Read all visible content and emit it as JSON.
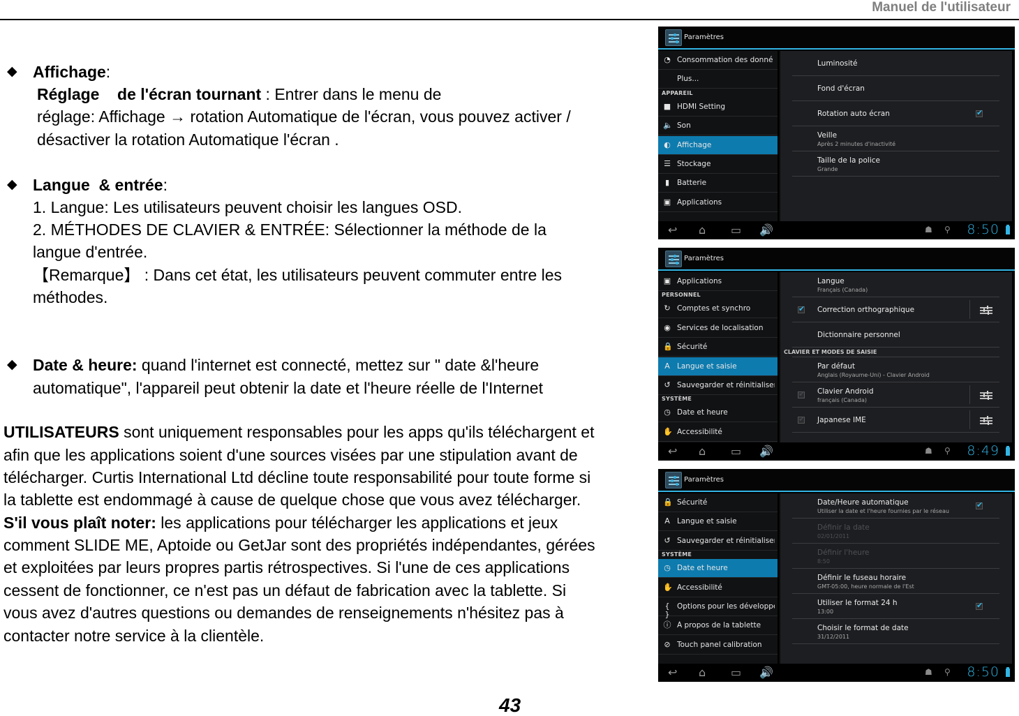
{
  "header": {
    "title": "Manuel de l'utilisateur"
  },
  "page_number": "43",
  "sections": {
    "affichage": {
      "title": "Affichage",
      "colon": ":",
      "subtitle": "Réglage    de l'écran tournant",
      "lines": [
        " : Entrer dans le menu de",
        "réglage: Affichage → rotation Automatique de l'écran, vous pouvez activer /",
        "désactiver la rotation Automatique l'écran ."
      ]
    },
    "langue": {
      "title": "Langue  & entrée",
      "colon": ":",
      "lines": [
        "1. Langue: Les utilisateurs peuvent choisir les langues OSD.",
        "2. MÉTHODES DE CLAVIER & ENTRÉE: Sélectionner la méthode de la",
        "langue d'entrée.",
        "【Remarque】 : Dans cet état, les utilisateurs peuvent commuter entre les",
        "méthodes."
      ]
    },
    "date": {
      "title": "Date & heure:",
      "lines": [
        " quand l'internet est connecté, mettez sur \" date &l'heure",
        "automatique\", l'appareil peut obtenir la date et l'heure réelle de l'Internet"
      ]
    },
    "disclaimer": {
      "lead": "UTILISATEURS",
      "line1_rest": " sont uniquement responsables pour les apps qu'ils téléchargent et",
      "lines": [
        "afin que les applications soient d'une sources visées par une stipulation avant de",
        "télécharger. Curtis International Ltd décline toute responsabilité pour toute forme si",
        "la tablette est endommagé à cause de quelque chose que vous avez télécharger."
      ],
      "note_lead": "S'il vous plaît noter:",
      "note_rest": " les applications pour télécharger les applications et jeux",
      "note_lines": [
        "comment SLIDE ME, Aptoide ou GetJar sont des propriétés indépendantes, gérées",
        "et exploitées par leurs propres partis rétrospectives. Si l'une de ces applications",
        "cessent de fonctionner, ce n'est pas un défaut de fabrication avec la tablette. Si",
        "vous avez d'autres questions ou demandes de renseignements n'hésitez pas à",
        "contacter notre service à la clientèle."
      ]
    }
  },
  "screenshots": [
    {
      "app_title": "Paramètres",
      "clock": "8:50",
      "left_items": [
        {
          "label": "Consommation des donné",
          "icon": "data-usage-icon",
          "glyph": "◔"
        },
        {
          "label": "Plus...",
          "icon": "",
          "glyph": ""
        },
        {
          "section": "APPAREIL"
        },
        {
          "label": "HDMI Setting",
          "icon": "hdmi-icon",
          "glyph": "■"
        },
        {
          "label": "Son",
          "icon": "sound-icon",
          "glyph": "🔈"
        },
        {
          "label": "Affichage",
          "icon": "display-icon",
          "glyph": "◐",
          "selected": true
        },
        {
          "label": "Stockage",
          "icon": "storage-icon",
          "glyph": "☰"
        },
        {
          "label": "Batterie",
          "icon": "battery-icon",
          "glyph": "▮"
        },
        {
          "label": "Applications",
          "icon": "apps-icon",
          "glyph": "▣"
        }
      ],
      "right_items": [
        {
          "title": "Luminosité"
        },
        {
          "title": "Fond d'écran"
        },
        {
          "title": "Rotation auto écran",
          "checked": true
        },
        {
          "title": "Veille",
          "summary": "Après 2 minutes d'inactivité"
        },
        {
          "title": "Taille de la police",
          "summary": "Grande"
        }
      ]
    },
    {
      "app_title": "Paramètres",
      "clock": "8:49",
      "left_items": [
        {
          "label": "Applications",
          "icon": "apps-icon",
          "glyph": "▣"
        },
        {
          "section": "PERSONNEL"
        },
        {
          "label": "Comptes et synchro",
          "icon": "sync-icon",
          "glyph": "↻"
        },
        {
          "label": "Services de localisation",
          "icon": "location-icon",
          "glyph": "◉"
        },
        {
          "label": "Sécurité",
          "icon": "lock-icon",
          "glyph": "🔒"
        },
        {
          "label": "Langue et saisie",
          "icon": "language-icon",
          "glyph": "A",
          "selected": true
        },
        {
          "label": "Sauvegarder et réinitialiser",
          "icon": "backup-icon",
          "glyph": "↺"
        },
        {
          "section": "SYSTÈME"
        },
        {
          "label": "Date et heure",
          "icon": "clock-icon",
          "glyph": "◷"
        },
        {
          "label": "Accessibilité",
          "icon": "hand-icon",
          "glyph": "✋"
        }
      ],
      "right_items": [
        {
          "title": "Langue",
          "summary": "Français (Canada)"
        },
        {
          "title": "Correction orthographique",
          "checked": true,
          "settings": true
        },
        {
          "title": "Dictionnaire personnel"
        },
        {
          "section": "CLAVIER ET MODES DE SAISIE"
        },
        {
          "title": "Par défaut",
          "summary": "Anglais (Royaume-Uni) - Clavier Android"
        },
        {
          "title": "Clavier Android",
          "summary": "français (Canada)",
          "dim_check": true,
          "settings": true
        },
        {
          "title": "Japanese IME",
          "dim_check": true,
          "settings": true
        }
      ]
    },
    {
      "app_title": "Paramètres",
      "clock": "8:50",
      "left_items": [
        {
          "label": "Sécurité",
          "icon": "lock-icon",
          "glyph": "🔒"
        },
        {
          "label": "Langue et saisie",
          "icon": "language-icon",
          "glyph": "A"
        },
        {
          "label": "Sauvegarder et réinitialiser",
          "icon": "backup-icon",
          "glyph": "↺"
        },
        {
          "section": "SYSTÈME"
        },
        {
          "label": "Date et heure",
          "icon": "clock-icon",
          "glyph": "◷",
          "selected": true
        },
        {
          "label": "Accessibilité",
          "icon": "hand-icon",
          "glyph": "✋"
        },
        {
          "label": "Options pour les développe",
          "icon": "developer-icon",
          "glyph": "{ }"
        },
        {
          "label": "À propos de la tablette",
          "icon": "info-icon",
          "glyph": "ⓘ"
        },
        {
          "label": "Touch panel calibration",
          "icon": "calibration-icon",
          "glyph": "⊘"
        }
      ],
      "right_items": [
        {
          "title": "Date/Heure automatique",
          "summary": "Utiliser la date et l'heure fournies par le réseau",
          "checked": true
        },
        {
          "title": "Définir la date",
          "summary": "02/01/2011",
          "disabled": true
        },
        {
          "title": "Définir l'heure",
          "summary": "8:50",
          "disabled": true
        },
        {
          "title": "Définir le fuseau horaire",
          "summary": "GMT-05:00, heure normale de l'Est"
        },
        {
          "title": "Utiliser le format 24 h",
          "summary": "13:00",
          "checked": true
        },
        {
          "title": "Choisir le format de date",
          "summary": "31/12/2011"
        }
      ]
    }
  ]
}
